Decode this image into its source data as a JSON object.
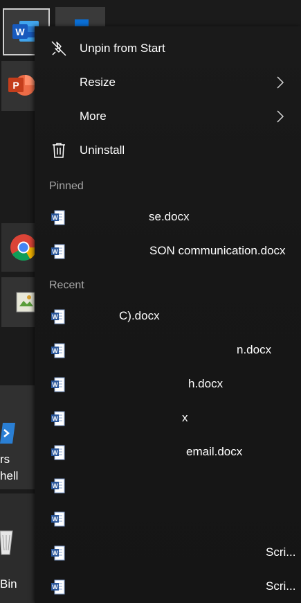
{
  "colors": {
    "menu_bg": "#1a1a1a",
    "text": "#ffffff",
    "section_header": "#a6a6a6",
    "word_blue": "#185abd",
    "powerpoint_orange": "#d24726"
  },
  "tiles": {
    "powershell_label_line1": "rs",
    "powershell_label_line2": "hell",
    "bin_label": "Bin"
  },
  "menu": {
    "items": [
      {
        "label": "Unpin from Start",
        "icon": "unpin-icon"
      },
      {
        "label": "Resize",
        "icon": "",
        "submenu": true
      },
      {
        "label": "More",
        "icon": "",
        "submenu": true
      },
      {
        "label": "Uninstall",
        "icon": "trash-icon"
      }
    ],
    "pinned_header": "Pinned",
    "pinned": [
      {
        "name": "se.docx",
        "icon": "word-doc-icon"
      },
      {
        "name": "SON communication.docx",
        "icon": "word-doc-icon"
      }
    ],
    "recent_header": "Recent",
    "recent": [
      {
        "name": "C).docx",
        "icon": "word-doc-icon"
      },
      {
        "name": "n.docx",
        "icon": "word-doc-icon"
      },
      {
        "name": "h.docx",
        "icon": "word-doc-icon"
      },
      {
        "name": "x",
        "icon": "word-doc-icon"
      },
      {
        "name": "email.docx",
        "icon": "word-doc-icon"
      },
      {
        "name": "",
        "icon": "word-doc-icon"
      },
      {
        "name": "",
        "icon": "word-doc-icon"
      },
      {
        "name": "Scri...",
        "icon": "word-doc-icon"
      },
      {
        "name": "Scri...",
        "icon": "word-doc-icon"
      }
    ]
  }
}
